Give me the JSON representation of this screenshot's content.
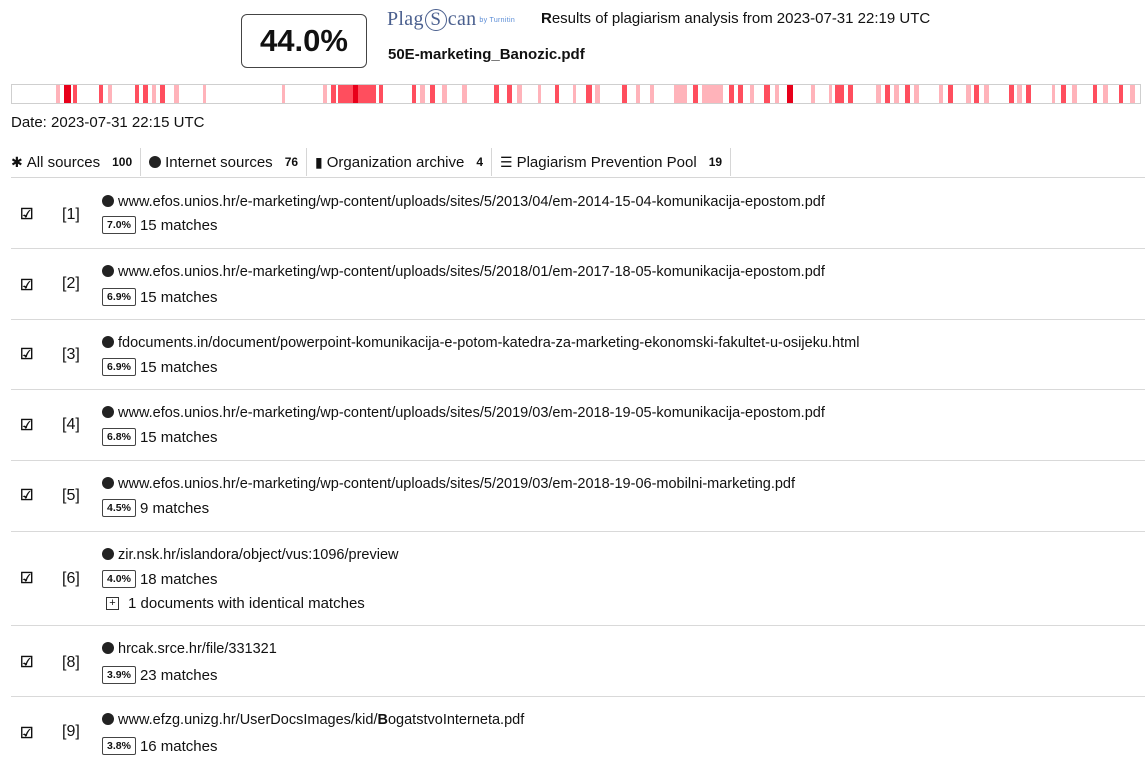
{
  "header": {
    "score": "44.0%",
    "logo_left": "Plag",
    "logo_s": "S",
    "logo_right": "can",
    "logo_by": "by Turnitin",
    "results_prefix": "R",
    "results_text": "esults of plagiarism analysis from",
    "results_datetime": "2023-07-31 22:19 UTC",
    "filename": "50E-marketing_Banozic.pdf"
  },
  "match_bar": {
    "colors": {
      "strong": "#e8001a",
      "medium": "#ff4e5e",
      "light": "#ffb3ba"
    },
    "segments": [
      {
        "a": 0.039,
        "b": 0.043,
        "t": "light"
      },
      {
        "a": 0.046,
        "b": 0.052,
        "t": "strong"
      },
      {
        "a": 0.054,
        "b": 0.058,
        "t": "medium"
      },
      {
        "a": 0.077,
        "b": 0.081,
        "t": "medium"
      },
      {
        "a": 0.085,
        "b": 0.089,
        "t": "light"
      },
      {
        "a": 0.109,
        "b": 0.113,
        "t": "medium"
      },
      {
        "a": 0.116,
        "b": 0.121,
        "t": "medium"
      },
      {
        "a": 0.124,
        "b": 0.128,
        "t": "light"
      },
      {
        "a": 0.131,
        "b": 0.136,
        "t": "medium"
      },
      {
        "a": 0.144,
        "b": 0.148,
        "t": "light"
      },
      {
        "a": 0.169,
        "b": 0.172,
        "t": "light"
      },
      {
        "a": 0.239,
        "b": 0.242,
        "t": "light"
      },
      {
        "a": 0.276,
        "b": 0.279,
        "t": "light"
      },
      {
        "a": 0.283,
        "b": 0.287,
        "t": "medium"
      },
      {
        "a": 0.289,
        "b": 0.323,
        "t": "medium"
      },
      {
        "a": 0.302,
        "b": 0.307,
        "t": "strong"
      },
      {
        "a": 0.325,
        "b": 0.329,
        "t": "medium"
      },
      {
        "a": 0.355,
        "b": 0.358,
        "t": "medium"
      },
      {
        "a": 0.362,
        "b": 0.366,
        "t": "light"
      },
      {
        "a": 0.371,
        "b": 0.375,
        "t": "medium"
      },
      {
        "a": 0.381,
        "b": 0.386,
        "t": "light"
      },
      {
        "a": 0.399,
        "b": 0.403,
        "t": "light"
      },
      {
        "a": 0.427,
        "b": 0.432,
        "t": "medium"
      },
      {
        "a": 0.439,
        "b": 0.443,
        "t": "medium"
      },
      {
        "a": 0.448,
        "b": 0.452,
        "t": "light"
      },
      {
        "a": 0.466,
        "b": 0.469,
        "t": "light"
      },
      {
        "a": 0.481,
        "b": 0.485,
        "t": "medium"
      },
      {
        "a": 0.497,
        "b": 0.5,
        "t": "light"
      },
      {
        "a": 0.509,
        "b": 0.514,
        "t": "medium"
      },
      {
        "a": 0.517,
        "b": 0.521,
        "t": "light"
      },
      {
        "a": 0.541,
        "b": 0.545,
        "t": "medium"
      },
      {
        "a": 0.553,
        "b": 0.557,
        "t": "light"
      },
      {
        "a": 0.566,
        "b": 0.569,
        "t": "light"
      },
      {
        "a": 0.587,
        "b": 0.598,
        "t": "light"
      },
      {
        "a": 0.604,
        "b": 0.608,
        "t": "medium"
      },
      {
        "a": 0.612,
        "b": 0.63,
        "t": "light"
      },
      {
        "a": 0.636,
        "b": 0.64,
        "t": "medium"
      },
      {
        "a": 0.644,
        "b": 0.648,
        "t": "medium"
      },
      {
        "a": 0.654,
        "b": 0.658,
        "t": "light"
      },
      {
        "a": 0.667,
        "b": 0.672,
        "t": "medium"
      },
      {
        "a": 0.676,
        "b": 0.68,
        "t": "light"
      },
      {
        "a": 0.687,
        "b": 0.692,
        "t": "strong"
      },
      {
        "a": 0.708,
        "b": 0.712,
        "t": "light"
      },
      {
        "a": 0.724,
        "b": 0.727,
        "t": "light"
      },
      {
        "a": 0.73,
        "b": 0.738,
        "t": "medium"
      },
      {
        "a": 0.741,
        "b": 0.746,
        "t": "medium"
      },
      {
        "a": 0.766,
        "b": 0.77,
        "t": "light"
      },
      {
        "a": 0.774,
        "b": 0.778,
        "t": "medium"
      },
      {
        "a": 0.782,
        "b": 0.786,
        "t": "light"
      },
      {
        "a": 0.792,
        "b": 0.796,
        "t": "medium"
      },
      {
        "a": 0.8,
        "b": 0.804,
        "t": "light"
      },
      {
        "a": 0.822,
        "b": 0.825,
        "t": "light"
      },
      {
        "a": 0.83,
        "b": 0.834,
        "t": "medium"
      },
      {
        "a": 0.846,
        "b": 0.85,
        "t": "light"
      },
      {
        "a": 0.853,
        "b": 0.857,
        "t": "medium"
      },
      {
        "a": 0.862,
        "b": 0.866,
        "t": "light"
      },
      {
        "a": 0.884,
        "b": 0.888,
        "t": "medium"
      },
      {
        "a": 0.891,
        "b": 0.895,
        "t": "light"
      },
      {
        "a": 0.899,
        "b": 0.903,
        "t": "medium"
      },
      {
        "a": 0.922,
        "b": 0.925,
        "t": "light"
      },
      {
        "a": 0.93,
        "b": 0.934,
        "t": "medium"
      },
      {
        "a": 0.94,
        "b": 0.944,
        "t": "light"
      },
      {
        "a": 0.958,
        "b": 0.962,
        "t": "medium"
      },
      {
        "a": 0.967,
        "b": 0.972,
        "t": "light"
      },
      {
        "a": 0.981,
        "b": 0.985,
        "t": "medium"
      },
      {
        "a": 0.991,
        "b": 0.996,
        "t": "light"
      }
    ]
  },
  "date_line": "Date: 2023-07-31 22:15 UTC",
  "tabs": [
    {
      "icon": "asterisk-icon",
      "glyph": "✱",
      "label": "All sources",
      "count": "100"
    },
    {
      "icon": "globe-icon",
      "glyph": "",
      "label": "Internet sources",
      "count": "76"
    },
    {
      "icon": "building-icon",
      "glyph": "▮",
      "label": "Organization archive",
      "count": "4"
    },
    {
      "icon": "database-icon",
      "glyph": "☰",
      "label": "Plagiarism Prevention Pool",
      "count": "19"
    }
  ],
  "sources": [
    {
      "idx": "[1]",
      "url": "www.efos.unios.hr/e-marketing/wp-content/uploads/sites/5/2013/04/em-2014-15-04-komunikacija-epostom.pdf",
      "pct": "7.0%",
      "matches": "15 matches"
    },
    {
      "idx": "[2]",
      "url": "www.efos.unios.hr/e-marketing/wp-content/uploads/sites/5/2018/01/em-2017-18-05-komunikacija-epostom.pdf",
      "pct": "6.9%",
      "matches": "15 matches"
    },
    {
      "idx": "[3]",
      "url": "fdocuments.in/document/powerpoint-komunikacija-e-potom-katedra-za-marketing-ekonomski-fakultet-u-osijeku.html",
      "pct": "6.9%",
      "matches": "15 matches"
    },
    {
      "idx": "[4]",
      "url": "www.efos.unios.hr/e-marketing/wp-content/uploads/sites/5/2019/03/em-2018-19-05-komunikacija-epostom.pdf",
      "pct": "6.8%",
      "matches": "15 matches"
    },
    {
      "idx": "[5]",
      "url": "www.efos.unios.hr/e-marketing/wp-content/uploads/sites/5/2019/03/em-2018-19-06-mobilni-marketing.pdf",
      "pct": "4.5%",
      "matches": "9 matches"
    },
    {
      "idx": "[6]",
      "url": "zir.nsk.hr/islandora/object/vus:1096/preview",
      "pct": "4.0%",
      "matches": "18 matches",
      "extra": "1 documents with identical matches"
    },
    {
      "idx": "[8]",
      "url": "hrcak.srce.hr/file/331321",
      "pct": "3.9%",
      "matches": "23 matches"
    },
    {
      "idx": "[9]",
      "url_pre": "www.efzg.unizg.hr/UserDocsImages/kid/",
      "url_b": "B",
      "url_mid": "ogatstvo",
      "url_i": "I",
      "url_post": "nterneta.pdf",
      "pct": "3.8%",
      "matches": "16 matches"
    }
  ],
  "checkbox_glyph": "☑"
}
